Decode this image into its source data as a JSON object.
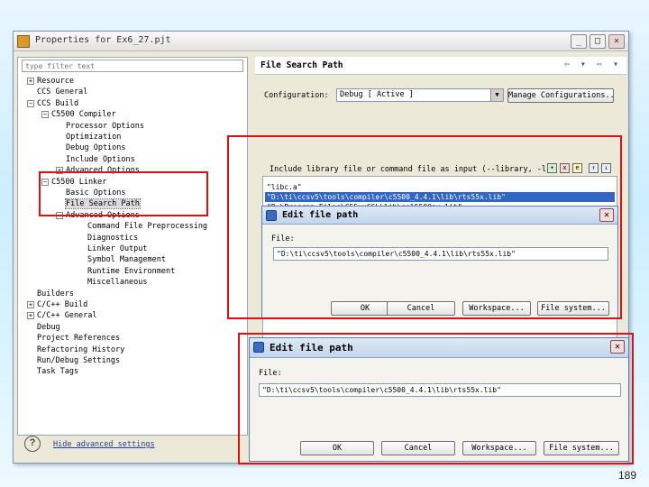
{
  "slide": {
    "title": "File Search Path",
    "deco_colon": ":",
    "deco_comma": ",",
    "page_number": "189"
  },
  "window": {
    "title": "Properties for Ex6_27.pjt",
    "buttons": {
      "minimize": "_",
      "maximize": "□",
      "close": "✕"
    }
  },
  "filter": {
    "placeholder": "type filter text"
  },
  "tree": [
    {
      "label": "Resource",
      "depth": 0,
      "expander": "+"
    },
    {
      "label": "CCS General",
      "depth": 0,
      "expander": ""
    },
    {
      "label": "CCS Build",
      "depth": 0,
      "expander": "−"
    },
    {
      "label": "C5500 Compiler",
      "depth": 1,
      "expander": "−"
    },
    {
      "label": "Processor Options",
      "depth": 2,
      "expander": ""
    },
    {
      "label": "Optimization",
      "depth": 2,
      "expander": ""
    },
    {
      "label": "Debug Options",
      "depth": 2,
      "expander": ""
    },
    {
      "label": "Include Options",
      "depth": 2,
      "expander": ""
    },
    {
      "label": "Advanced Options",
      "depth": 2,
      "expander": "+"
    },
    {
      "label": "C5500 Linker",
      "depth": 1,
      "expander": "−"
    },
    {
      "label": "Basic Options",
      "depth": 2,
      "expander": ""
    },
    {
      "label": "File Search Path",
      "depth": 2,
      "expander": "",
      "selected": true
    },
    {
      "label": "Advanced Options",
      "depth": 2,
      "expander": "−"
    },
    {
      "label": "Command File Preprocessing",
      "depth": 3,
      "expander": ""
    },
    {
      "label": "Diagnostics",
      "depth": 3,
      "expander": ""
    },
    {
      "label": "Linker Output",
      "depth": 3,
      "expander": ""
    },
    {
      "label": "Symbol Management",
      "depth": 3,
      "expander": ""
    },
    {
      "label": "Runtime Environment",
      "depth": 3,
      "expander": ""
    },
    {
      "label": "Miscellaneous",
      "depth": 3,
      "expander": ""
    },
    {
      "label": "Builders",
      "depth": 0,
      "expander": ""
    },
    {
      "label": "C/C++ Build",
      "depth": 0,
      "expander": "+"
    },
    {
      "label": "C/C++ General",
      "depth": 0,
      "expander": "+"
    },
    {
      "label": "Debug",
      "depth": 0,
      "expander": ""
    },
    {
      "label": "Project References",
      "depth": 0,
      "expander": ""
    },
    {
      "label": "Refactoring History",
      "depth": 0,
      "expander": ""
    },
    {
      "label": "Run/Debug Settings",
      "depth": 0,
      "expander": ""
    },
    {
      "label": "Task Tags",
      "depth": 0,
      "expander": ""
    }
  ],
  "section": {
    "title": "File Search Path",
    "nav": "⇦ ▾ ⇨ ▾"
  },
  "configuration": {
    "label": "Configuration:",
    "value": "Debug  [ Active ]",
    "manage_button": "Manage Configurations..."
  },
  "include": {
    "label": "Include library file or command file as input (--library, -l)",
    "tools": [
      "+",
      "x",
      "e",
      "↑",
      "↓"
    ],
    "items": [
      {
        "text": "\"libc.a\"",
        "selected": false
      },
      {
        "text": "\"D:\\ti\\ccsv5\\tools\\compiler\\c5500_4.4.1\\lib\\rts55x.lib\"",
        "selected": true
      },
      {
        "text": "\"D:\\Program Files\\C55xxCSL\\lib\\csl5500ax.lib\"",
        "selected": false
      }
    ]
  },
  "help": {
    "icon": "?",
    "link": "Hide advanced settings"
  },
  "dialog_small": {
    "title": "Edit file path",
    "close": "✕",
    "file_label": "File:",
    "file_value": "\"D:\\ti\\ccsv5\\tools\\compiler\\c5500_4.4.1\\lib\\rts55x.lib\"",
    "buttons": [
      "OK",
      "Cancel",
      "Workspace...",
      "File system..."
    ]
  },
  "dialog_large": {
    "title": "Edit file path",
    "close": "✕",
    "file_label": "File:",
    "file_value": "\"D:\\ti\\ccsv5\\tools\\compiler\\c5500_4.4.1\\lib\\rts55x.lib\"",
    "buttons": [
      "OK",
      "Cancel",
      "Workspace...",
      "File system..."
    ]
  },
  "colors": {
    "highlight_red": "#e01010",
    "selection_blue": "#3166c5",
    "title_red": "#e53935"
  }
}
